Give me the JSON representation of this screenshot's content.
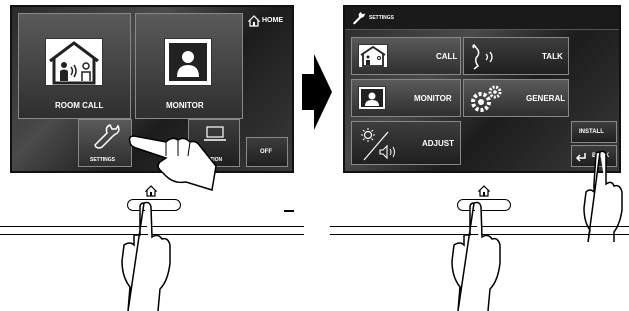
{
  "left_screen": {
    "home_label": "HOME",
    "room_call_label": "ROOM CALL",
    "monitor_label": "MONITOR",
    "settings_label": "SETTINGS",
    "option_label": "OPTION",
    "off_label": "OFF",
    "icons": [
      "home-icon",
      "room-call-icon",
      "monitor-icon",
      "wrench-icon",
      "laptop-icon"
    ]
  },
  "right_screen": {
    "title": "SETTINGS",
    "call_label": "CALL",
    "talk_label": "TALK",
    "monitor_label": "MONITOR",
    "general_label": "GENERAL",
    "adjust_label": "ADJUST",
    "install_label": "INSTALL",
    "back_label": "BACK",
    "icons": [
      "wrench-icon",
      "room-call-icon",
      "handset-icon",
      "monitor-icon",
      "gears-icon",
      "brightness-volume-icon",
      "back-arrow-icon"
    ]
  },
  "arrow": {
    "direction": "right"
  },
  "colors": {
    "screen_dark": "#2a2a2a",
    "button_border": "#888888",
    "text": "#ffffff"
  }
}
